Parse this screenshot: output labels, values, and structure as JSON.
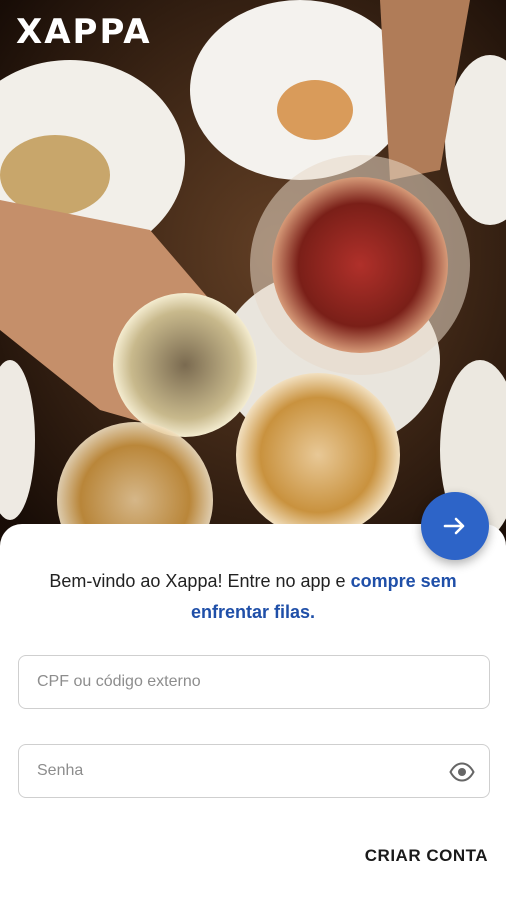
{
  "logo": {
    "text": "XAPPA"
  },
  "hero": {
    "description_icon": "drinks-toast-photo"
  },
  "welcome": {
    "text_plain": "Bem-vindo ao Xappa! Entre no app e ",
    "text_highlight": "compre sem enfrentar filas."
  },
  "form": {
    "cpf_placeholder": "CPF ou código externo",
    "password_placeholder": "Senha"
  },
  "actions": {
    "next_icon": "arrow-right-icon",
    "create_account_label": "CRIAR CONTA"
  },
  "colors": {
    "accent": "#2d64c8",
    "highlight_text": "#1f4fa8"
  }
}
